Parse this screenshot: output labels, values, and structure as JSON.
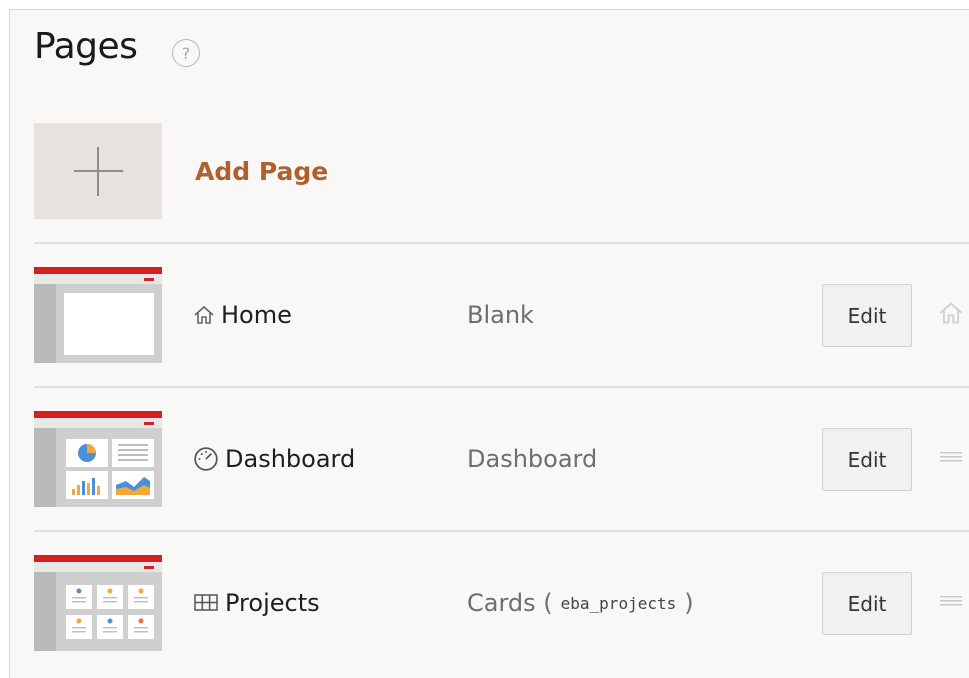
{
  "header": {
    "title": "Pages",
    "help_icon": "?"
  },
  "add_page": {
    "label": "Add Page"
  },
  "pages": [
    {
      "name": "Home",
      "type": "Blank",
      "source": "",
      "type_suffix": "",
      "edit_label": "Edit",
      "icon": "home-icon",
      "trailing_icon": "home-icon"
    },
    {
      "name": "Dashboard",
      "type": "Dashboard",
      "source": "",
      "type_suffix": "",
      "edit_label": "Edit",
      "icon": "gauge-icon",
      "trailing_icon": "drag-handle-icon"
    },
    {
      "name": "Projects",
      "type": "Cards (",
      "source": "eba_projects",
      "type_suffix": ")",
      "edit_label": "Edit",
      "icon": "cards-grid-icon",
      "trailing_icon": "drag-handle-icon"
    }
  ],
  "colors": {
    "accent": "#b0602a",
    "thumb_red": "#d21f1f",
    "divider": "#e2e0dd"
  }
}
